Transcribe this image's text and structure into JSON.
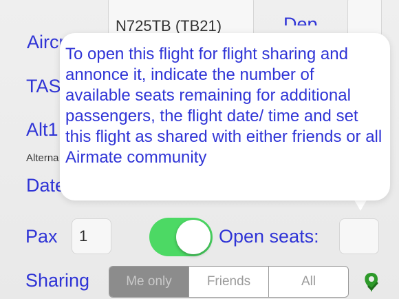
{
  "form": {
    "aircraft_label": "Aircr",
    "aircraft_value": "N725TB (TB21)",
    "dep_label": "Dep",
    "tas_label": "TAS",
    "alt1_label": "Alt1",
    "alternate_label": "Alterna",
    "date_label": "Date",
    "pax_label": "Pax",
    "pax_value": "1",
    "open_seats_toggle_on": true,
    "open_seats_label": "Open seats:",
    "open_seats_value": "",
    "sharing_label": "Sharing"
  },
  "sharing_options": [
    "Me only",
    "Friends",
    "All"
  ],
  "sharing_selected": "Me only",
  "tooltip": {
    "text": "To open this flight for flight sharing and annonce it, indicate the number of available seats remaining for additional passengers, the flight date/ time and set this flight as shared with either friends or all Airmate community"
  },
  "colors": {
    "label_blue": "#2f34d6",
    "toggle_green": "#4cd964",
    "segment_selected": "#8c8c8c",
    "icon_green": "#2e9a2a"
  },
  "icons": {
    "sharing_status": "green-leaf-check-icon"
  }
}
